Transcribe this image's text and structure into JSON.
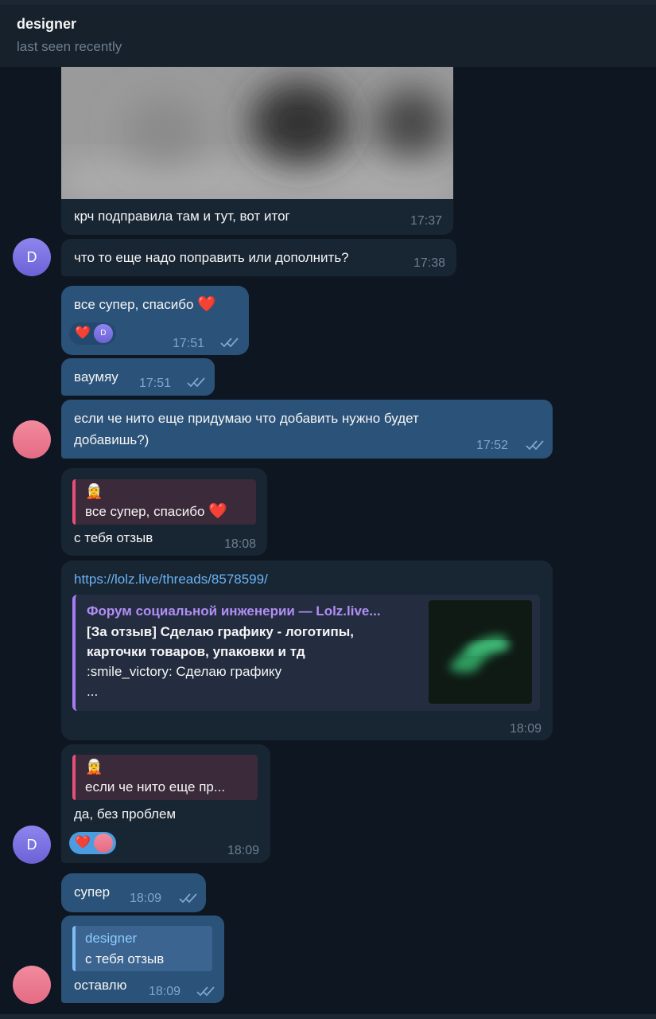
{
  "header": {
    "title": "designer",
    "status": "last seen recently"
  },
  "messages": {
    "m1": {
      "text": "крч подправила там и тут, вот итог",
      "time": "17:37"
    },
    "m2": {
      "text": "что то еще надо поправить или дополнить?",
      "time": "17:38",
      "avatar": "D"
    },
    "m3": {
      "text": "все супер, спасибо",
      "emoji": "❤️",
      "time": "17:51",
      "reaction": "❤️",
      "reaction_avatar": "D"
    },
    "m4": {
      "text": "ваумяу",
      "time": "17:51"
    },
    "m5": {
      "line1": "если че нито еще придумаю что добавить нужно будет",
      "line2": "добавишь?)",
      "time": "17:52"
    },
    "m6": {
      "quote_emoji": "🧝",
      "quote_text": "все супер, спасибо",
      "quote_heart": "❤️",
      "text": "с тебя отзыв",
      "time": "18:08"
    },
    "m7": {
      "link": "https://lolz.live/threads/8578599/",
      "site": "Форум социальной инженерии —  Lolz.live...",
      "title1": "[За отзыв] Сделаю графику - логотипы,",
      "title2": "карточки товаров, упаковки и тд",
      "desc": ":smile_victory: Сделаю графику",
      "more": "...",
      "time": "18:09"
    },
    "m8": {
      "quote_emoji": "🧝",
      "quote_text": "если че нито еще пр...",
      "text": "да, без проблем",
      "reaction": "❤️",
      "time": "18:09",
      "avatar": "D"
    },
    "m9": {
      "text": "супер",
      "time": "18:09"
    },
    "m10": {
      "quote_name": "designer",
      "quote_text": "с тебя отзыв",
      "text": "оставлю",
      "time": "18:09"
    }
  },
  "colors": {
    "accent": "#2b5278",
    "incoming": "#182533",
    "pink_quote": "#e94e77",
    "blue_quote": "#7fbef4"
  }
}
